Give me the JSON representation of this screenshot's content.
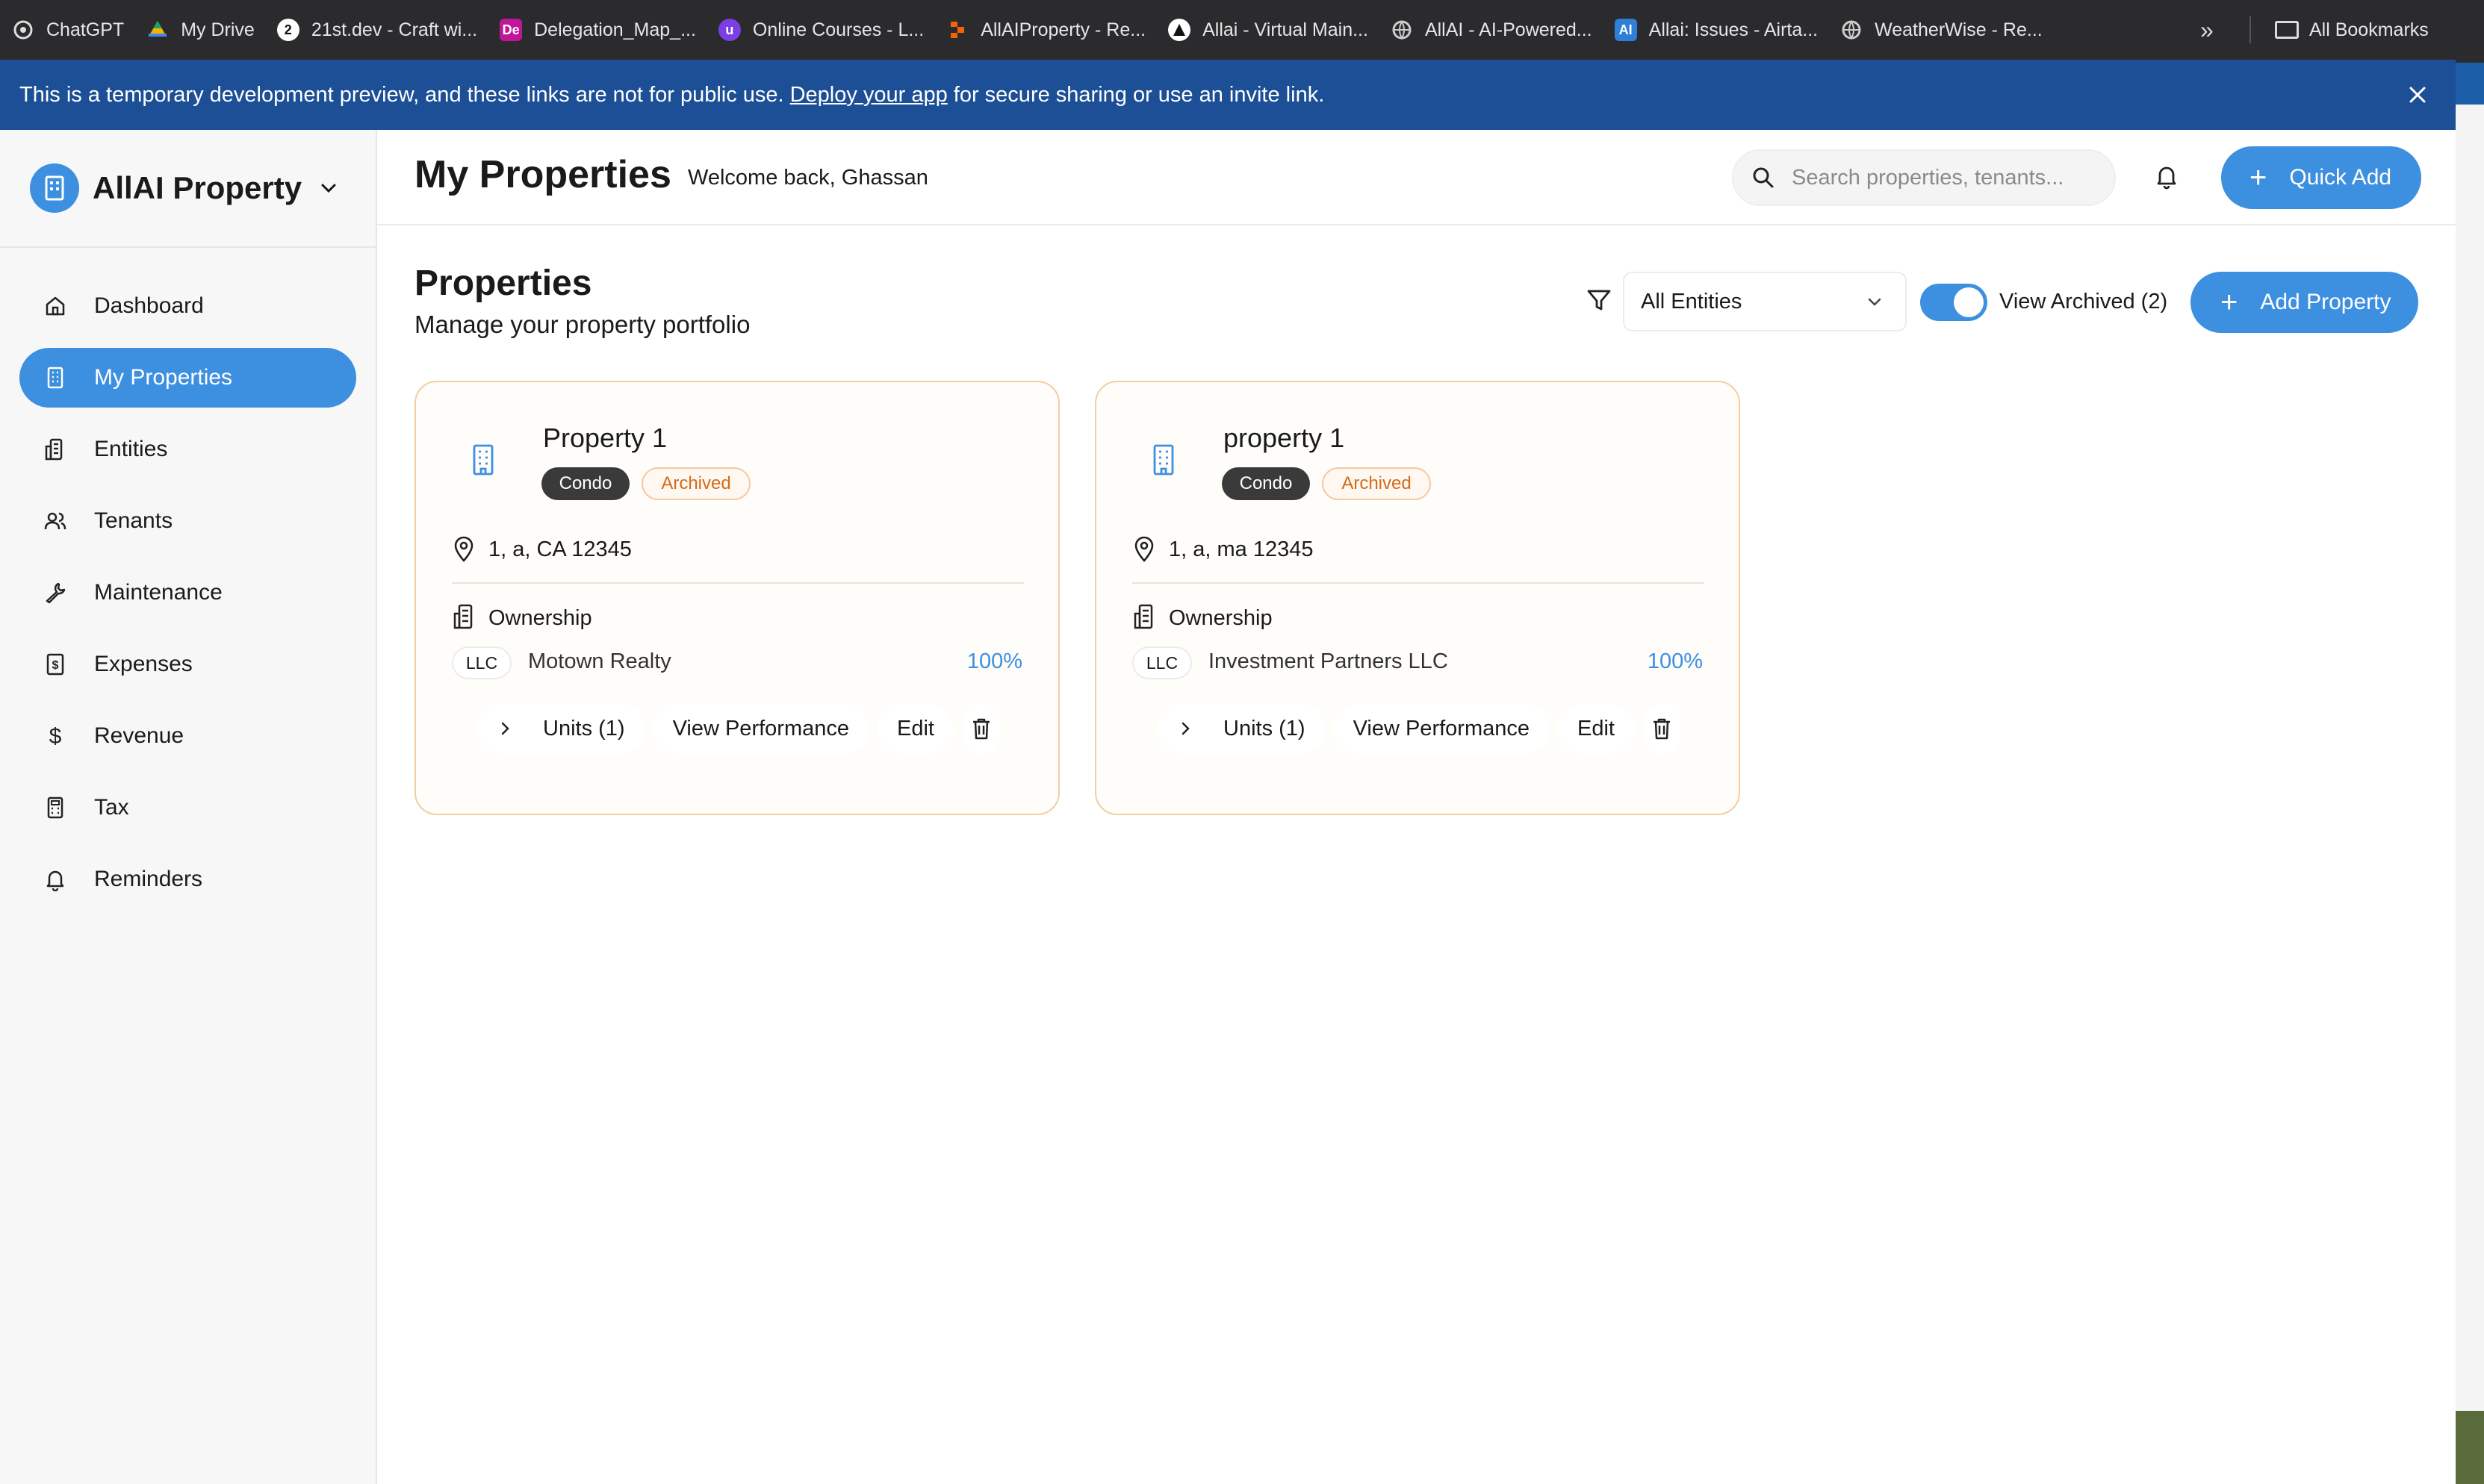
{
  "bookmarks": [
    {
      "label": "ChatGPT",
      "fav": "",
      "color": "#2b2b2e"
    },
    {
      "label": "My Drive",
      "fav": "",
      "color": "#2b2b2e"
    },
    {
      "label": "21st.dev - Craft wi...",
      "fav": "",
      "color": "#111111"
    },
    {
      "label": "Delegation_Map_...",
      "fav": "De",
      "color": "#c2169a"
    },
    {
      "label": "Online Courses - L...",
      "fav": "",
      "color": "#7b3fe4"
    },
    {
      "label": "AllAIProperty - Re...",
      "fav": "",
      "color": "#2b2b2e"
    },
    {
      "label": "Allai - Virtual Main...",
      "fav": "",
      "color": "#111111"
    },
    {
      "label": "AllAI - AI-Powered...",
      "fav": "",
      "color": "#2b2b2e"
    },
    {
      "label": "Allai: Issues - Airta...",
      "fav": "AI",
      "color": "#2f7fd6"
    },
    {
      "label": "WeatherWise - Re...",
      "fav": "",
      "color": "#2b2b2e"
    }
  ],
  "bookmarks_more": "»",
  "all_bookmarks": "All Bookmarks",
  "banner": {
    "text_before": "This is a temporary development preview, and these links are not for public use.",
    "link": "Deploy your app",
    "text_after": "for secure sharing or use an invite link."
  },
  "sidebar": {
    "brand": "AllAI Property",
    "items": [
      {
        "label": "Dashboard",
        "icon": "home-icon",
        "active": false
      },
      {
        "label": "My Properties",
        "icon": "building-icon",
        "active": true
      },
      {
        "label": "Entities",
        "icon": "entities-icon",
        "active": false
      },
      {
        "label": "Tenants",
        "icon": "users-icon",
        "active": false
      },
      {
        "label": "Maintenance",
        "icon": "wrench-icon",
        "active": false
      },
      {
        "label": "Expenses",
        "icon": "receipt-icon",
        "active": false
      },
      {
        "label": "Revenue",
        "icon": "dollar-icon",
        "active": false
      },
      {
        "label": "Tax",
        "icon": "calculator-icon",
        "active": false
      },
      {
        "label": "Reminders",
        "icon": "bell-icon",
        "active": false
      }
    ]
  },
  "header": {
    "title": "My Properties",
    "welcome": "Welcome back, Ghassan",
    "search_placeholder": "Search properties, tenants...",
    "quick_add": "Quick Add"
  },
  "main": {
    "title": "Properties",
    "subtitle": "Manage your property portfolio",
    "entity_filter": "All Entities",
    "view_archived": "View Archived (2)",
    "view_archived_on": true,
    "add_property": "Add Property"
  },
  "properties": [
    {
      "name": "Property 1",
      "type": "Condo",
      "status": "Archived",
      "address": "1, a, CA 12345",
      "ownership_label": "Ownership",
      "owner_type": "LLC",
      "owner": "Motown Realty",
      "share": "100%",
      "units": "Units (1)",
      "performance": "View Performance",
      "edit": "Edit"
    },
    {
      "name": "property 1",
      "type": "Condo",
      "status": "Archived",
      "address": "1, a, ma 12345",
      "ownership_label": "Ownership",
      "owner_type": "LLC",
      "owner": "Investment Partners LLC",
      "share": "100%",
      "units": "Units (1)",
      "performance": "View Performance",
      "edit": "Edit"
    }
  ],
  "colors": {
    "accent": "#3d8fe0",
    "banner": "#1c4f96",
    "archived_text": "#d26a1a",
    "card_border": "#f0cfa2"
  }
}
